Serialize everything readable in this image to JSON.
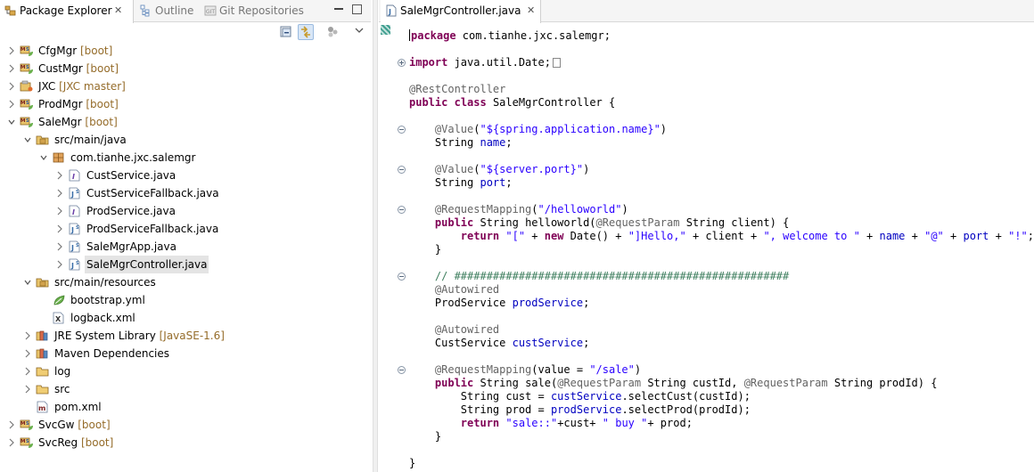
{
  "left_tabs": {
    "package_explorer": "Package Explorer",
    "outline": "Outline",
    "git_repositories": "Git Repositories",
    "close_glyph": "✕"
  },
  "tree": [
    {
      "label": "CfgMgr",
      "decoration": "[boot]",
      "icon": "maven-spring-project-icon",
      "expanded": false
    },
    {
      "label": "CustMgr",
      "decoration": "[boot]",
      "icon": "maven-spring-project-icon",
      "expanded": false
    },
    {
      "label": "JXC",
      "decoration": "[JXC master]",
      "icon": "git-project-icon",
      "expanded": false
    },
    {
      "label": "ProdMgr",
      "decoration": "[boot]",
      "icon": "maven-spring-project-icon",
      "expanded": false
    },
    {
      "label": "SaleMgr",
      "decoration": "[boot]",
      "icon": "maven-spring-project-icon",
      "expanded": true
    },
    {
      "label": "src/main/java",
      "decoration": "",
      "icon": "source-folder-icon",
      "expanded": true
    },
    {
      "label": "com.tianhe.jxc.salemgr",
      "decoration": "",
      "icon": "package-icon",
      "expanded": true
    },
    {
      "label": "CustService.java",
      "decoration": "",
      "icon": "java-interface-file-icon",
      "expanded": false
    },
    {
      "label": "CustServiceFallback.java",
      "decoration": "",
      "icon": "java-spring-file-icon",
      "expanded": false
    },
    {
      "label": "ProdService.java",
      "decoration": "",
      "icon": "java-interface-file-icon",
      "expanded": false
    },
    {
      "label": "ProdServiceFallback.java",
      "decoration": "",
      "icon": "java-spring-file-icon",
      "expanded": false
    },
    {
      "label": "SaleMgrApp.java",
      "decoration": "",
      "icon": "java-spring-file-icon",
      "expanded": false
    },
    {
      "label": "SaleMgrController.java",
      "decoration": "",
      "icon": "java-spring-file-icon",
      "expanded": false,
      "selected": true
    },
    {
      "label": "src/main/resources",
      "decoration": "",
      "icon": "source-folder-icon",
      "expanded": true
    },
    {
      "label": "bootstrap.yml",
      "decoration": "",
      "icon": "spring-yml-icon",
      "expanded": false
    },
    {
      "label": "logback.xml",
      "decoration": "",
      "icon": "xml-file-icon",
      "expanded": false
    },
    {
      "label": "JRE System Library",
      "decoration": "[JavaSE-1.6]",
      "icon": "library-icon",
      "expanded": false
    },
    {
      "label": "Maven Dependencies",
      "decoration": "",
      "icon": "library-icon",
      "expanded": false
    },
    {
      "label": "log",
      "decoration": "",
      "icon": "folder-icon",
      "expanded": false
    },
    {
      "label": "src",
      "decoration": "",
      "icon": "folder-icon",
      "expanded": false
    },
    {
      "label": "pom.xml",
      "decoration": "",
      "icon": "maven-pom-icon",
      "expanded": false
    },
    {
      "label": "SvcGw",
      "decoration": "[boot]",
      "icon": "maven-spring-project-icon",
      "expanded": false
    },
    {
      "label": "SvcReg",
      "decoration": "[boot]",
      "icon": "maven-spring-project-icon",
      "expanded": false
    }
  ],
  "editor": {
    "tab_title": "SaleMgrController.java",
    "lines": [
      [
        [
          "kw",
          "package"
        ],
        [
          "t",
          " com.tianhe.jxc.salemgr;"
        ]
      ],
      [],
      [
        [
          "kw",
          "import"
        ],
        [
          "t",
          " java.util.Date;"
        ]
      ],
      [],
      [
        [
          "an",
          "@RestController"
        ]
      ],
      [
        [
          "kw",
          "public"
        ],
        [
          "t",
          " "
        ],
        [
          "kw",
          "class"
        ],
        [
          "t",
          " SaleMgrController {"
        ]
      ],
      [],
      [
        [
          "t",
          "    "
        ],
        [
          "an",
          "@Value"
        ],
        [
          "t",
          "("
        ],
        [
          "st",
          "\"${spring.application.name}\""
        ],
        [
          "t",
          ")"
        ]
      ],
      [
        [
          "t",
          "    String "
        ],
        [
          "fd",
          "name"
        ],
        [
          "t",
          ";"
        ]
      ],
      [],
      [
        [
          "t",
          "    "
        ],
        [
          "an",
          "@Value"
        ],
        [
          "t",
          "("
        ],
        [
          "st",
          "\"${server.port}\""
        ],
        [
          "t",
          ")"
        ]
      ],
      [
        [
          "t",
          "    String "
        ],
        [
          "fd",
          "port"
        ],
        [
          "t",
          ";"
        ]
      ],
      [],
      [
        [
          "t",
          "    "
        ],
        [
          "an",
          "@RequestMapping"
        ],
        [
          "t",
          "("
        ],
        [
          "st",
          "\"/helloworld\""
        ],
        [
          "t",
          ")"
        ]
      ],
      [
        [
          "t",
          "    "
        ],
        [
          "kw",
          "public"
        ],
        [
          "t",
          " String helloworld("
        ],
        [
          "an",
          "@RequestParam"
        ],
        [
          "t",
          " String client) {"
        ]
      ],
      [
        [
          "t",
          "        "
        ],
        [
          "kw",
          "return"
        ],
        [
          "t",
          " "
        ],
        [
          "st",
          "\"[\""
        ],
        [
          "t",
          " + "
        ],
        [
          "kw",
          "new"
        ],
        [
          "t",
          " Date() + "
        ],
        [
          "st",
          "\"]Hello,\""
        ],
        [
          "t",
          " + client + "
        ],
        [
          "st",
          "\", welcome to \""
        ],
        [
          "t",
          " + "
        ],
        [
          "fd",
          "name"
        ],
        [
          "t",
          " + "
        ],
        [
          "st",
          "\"@\""
        ],
        [
          "t",
          " + "
        ],
        [
          "fd",
          "port"
        ],
        [
          "t",
          " + "
        ],
        [
          "st",
          "\"!\""
        ],
        [
          "t",
          ";"
        ]
      ],
      [
        [
          "t",
          "    }"
        ]
      ],
      [],
      [
        [
          "t",
          "    "
        ],
        [
          "cm",
          "// ####################################################"
        ]
      ],
      [
        [
          "t",
          "    "
        ],
        [
          "an",
          "@Autowired"
        ]
      ],
      [
        [
          "t",
          "    ProdService "
        ],
        [
          "fd",
          "prodService"
        ],
        [
          "t",
          ";"
        ]
      ],
      [],
      [
        [
          "t",
          "    "
        ],
        [
          "an",
          "@Autowired"
        ]
      ],
      [
        [
          "t",
          "    CustService "
        ],
        [
          "fd",
          "custService"
        ],
        [
          "t",
          ";"
        ]
      ],
      [],
      [
        [
          "t",
          "    "
        ],
        [
          "an",
          "@RequestMapping"
        ],
        [
          "t",
          "(value = "
        ],
        [
          "st",
          "\"/sale\""
        ],
        [
          "t",
          ")"
        ]
      ],
      [
        [
          "t",
          "    "
        ],
        [
          "kw",
          "public"
        ],
        [
          "t",
          " String sale("
        ],
        [
          "an",
          "@RequestParam"
        ],
        [
          "t",
          " String custId, "
        ],
        [
          "an",
          "@RequestParam"
        ],
        [
          "t",
          " String prodId) {"
        ]
      ],
      [
        [
          "t",
          "        String cust = "
        ],
        [
          "fd",
          "custService"
        ],
        [
          "t",
          ".selectCust(custId);"
        ]
      ],
      [
        [
          "t",
          "        String prod = "
        ],
        [
          "fd",
          "prodService"
        ],
        [
          "t",
          ".selectProd(prodId);"
        ]
      ],
      [
        [
          "t",
          "        "
        ],
        [
          "kw",
          "return"
        ],
        [
          "t",
          " "
        ],
        [
          "st",
          "\"sale::\""
        ],
        [
          "t",
          "+cust+ "
        ],
        [
          "st",
          "\" buy \""
        ],
        [
          "t",
          "+ prod;"
        ]
      ],
      [
        [
          "t",
          "    }"
        ]
      ],
      [],
      [
        [
          "t",
          "}"
        ]
      ]
    ]
  },
  "colors": {
    "keyword": "#7f0055",
    "annotation": "#646464",
    "string": "#2a00ff",
    "field": "#0000c0",
    "comment": "#3f7f5f",
    "decoration": "#956c2a"
  }
}
